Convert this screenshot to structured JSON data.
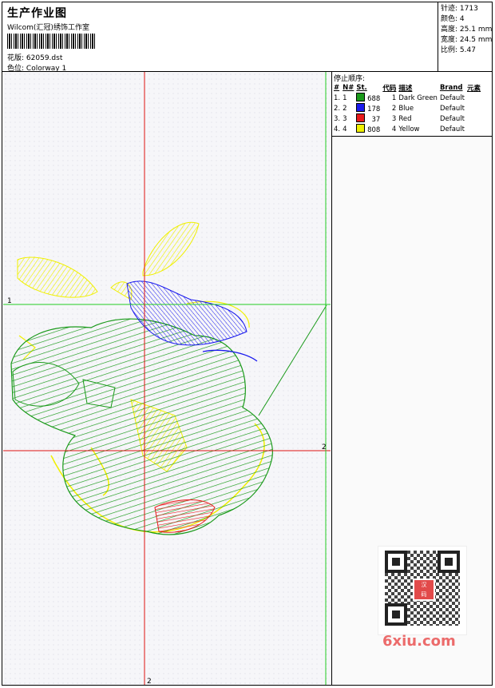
{
  "header": {
    "title": "生产作业图",
    "studio": "Wilcom(汇冠)绣饰工作室",
    "design_label": "花版:",
    "design_file": "62059.dst",
    "colorway_label": "色位:",
    "colorway": "Colorway 1"
  },
  "stats": [
    {
      "label": "针迹:",
      "value": "1713"
    },
    {
      "label": "颜色:",
      "value": "4"
    },
    {
      "label": "高度:",
      "value": "25.1 mm"
    },
    {
      "label": "宽度:",
      "value": "24.5 mm"
    },
    {
      "label": "比例:",
      "value": "5.47"
    }
  ],
  "stop_sequence": {
    "title": "停止顺序:",
    "headers": [
      "#",
      "N#",
      "St.",
      "代码",
      "描述",
      "Brand",
      "元素"
    ],
    "rows": [
      {
        "idx": "1.",
        "n": "1",
        "stitches": "688",
        "code": "1",
        "desc": "Dark Green",
        "brand": "Default",
        "color": "#1a9a1a"
      },
      {
        "idx": "2.",
        "n": "2",
        "stitches": "178",
        "code": "2",
        "desc": "Blue",
        "brand": "Default",
        "color": "#1a1aee"
      },
      {
        "idx": "3.",
        "n": "3",
        "stitches": "37",
        "code": "3",
        "desc": "Red",
        "brand": "Default",
        "color": "#e81a1a"
      },
      {
        "idx": "4.",
        "n": "4",
        "stitches": "808",
        "code": "4",
        "desc": "Yellow",
        "brand": "Default",
        "color": "#f0f000"
      }
    ]
  },
  "guides": {
    "marker_1": "1",
    "marker_2": "2"
  },
  "watermark": {
    "qr_logo_text": "汉\n码",
    "site": "6xiu.com"
  },
  "colors": {
    "guide_green": "#22cc22",
    "guide_red": "#dd1111"
  }
}
